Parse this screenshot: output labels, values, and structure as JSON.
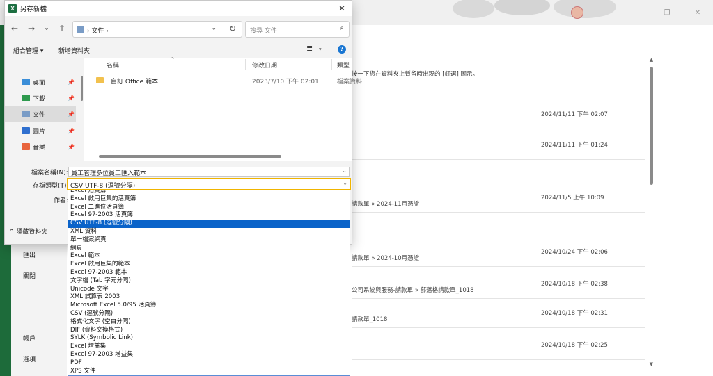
{
  "background": {
    "menu": [
      "匯出",
      "關閉",
      "帳戶",
      "選項"
    ],
    "pin_hint": "按一下您在資料夾上暫留時出現的 [釘選] 圖示。",
    "rows": [
      {
        "path": "",
        "date": "2024/11/11 下午 02:07"
      },
      {
        "path": "",
        "date": "2024/11/11 下午 01:24"
      },
      {
        "path": "請款單 » 2024-11月憑證",
        "date": "2024/11/5 上午 10:09"
      },
      {
        "path": "請款單 » 2024-10月憑證",
        "date": "2024/10/24 下午 02:06"
      },
      {
        "path": "公司系統與服務-請款單 » 部落格請款單_1018",
        "date": "2024/10/18 下午 02:38"
      },
      {
        "path": "請款單_1018",
        "date": "2024/10/18 下午 02:31"
      },
      {
        "path": "",
        "date": "2024/10/18 下午 02:25"
      }
    ]
  },
  "dialog": {
    "title": "另存新檔",
    "address": "文件",
    "search_placeholder": "搜尋 文件",
    "toolbar": {
      "organize": "組合管理 ▾",
      "new_folder": "新增資料夾"
    },
    "nav_items": [
      {
        "label": "桌面",
        "color": "#3b8ed8"
      },
      {
        "label": "下載",
        "color": "#2e9a4e"
      },
      {
        "label": "文件",
        "color": "#7a9cc6"
      },
      {
        "label": "圖片",
        "color": "#2f6fcf"
      },
      {
        "label": "音樂",
        "color": "#e8643c"
      }
    ],
    "columns": {
      "name": "名稱",
      "modified": "修改日期",
      "type": "類型"
    },
    "file": {
      "name": "自訂 Office 範本",
      "modified": "2023/7/10 下午 02:01",
      "type": "檔案資料"
    },
    "filename_label": "檔案名稱(N):",
    "filename_value": "員工管理多位員工匯入範本",
    "filetype_label": "存檔類型(T):",
    "filetype_value": "CSV UTF-8 (逗號分隔)",
    "author_label": "作者:",
    "hide_folders": "隱藏資料夾"
  },
  "file_types": [
    "Excel 活頁簿",
    "Excel 啟用巨集的活頁簿",
    "Excel 二進位活頁簿",
    "Excel 97-2003 活頁簿",
    "CSV UTF-8 (逗號分隔)",
    "XML 資料",
    "單一檔案網頁",
    "網頁",
    "Excel 範本",
    "Excel 啟用巨集的範本",
    "Excel 97-2003 範本",
    "文字檔 (Tab 字元分隔)",
    "Unicode 文字",
    "XML 試算表 2003",
    "Microsoft Excel 5.0/95 活頁簿",
    "CSV (逗號分隔)",
    "格式化文字 (空白分隔)",
    "DIF (資料交換格式)",
    "SYLK (Symbolic Link)",
    "Excel 增益集",
    "Excel 97-2003 增益集",
    "PDF",
    "XPS 文件"
  ],
  "selected_type_index": 4
}
